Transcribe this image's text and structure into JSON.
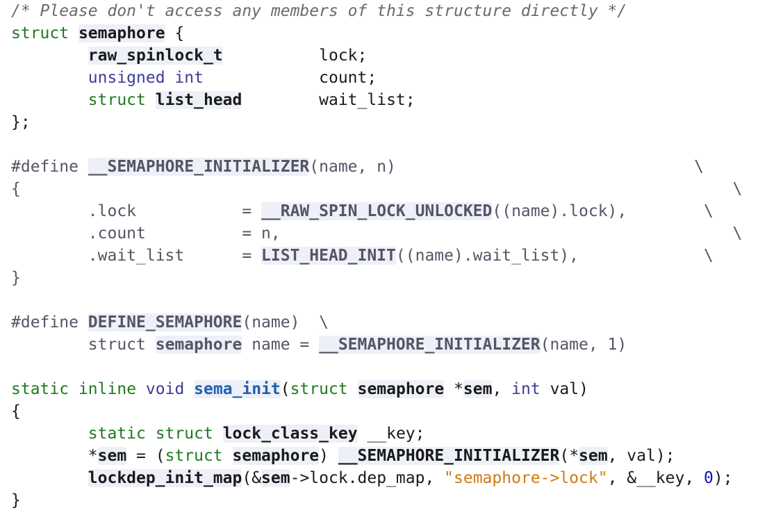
{
  "editor": {
    "language": "C",
    "colors": {
      "comment": "#6a6a6a",
      "keyword": "#1e7a1e",
      "type": "#3c3c9a",
      "function": "#2060b0",
      "string": "#d07a10",
      "number": "#1010c0",
      "preprocessor": "#556677",
      "reference_bg": "#eef0f8"
    },
    "lines": [
      [
        {
          "t": "/* Please don't access any members of this structure directly */",
          "c": "comment"
        }
      ],
      [
        {
          "t": "struct",
          "c": "kw"
        },
        {
          "t": " ",
          "c": "plain"
        },
        {
          "t": "semaphore",
          "c": "ref"
        },
        {
          "t": " {",
          "c": "plain"
        }
      ],
      [
        {
          "t": "        ",
          "c": "plain"
        },
        {
          "t": "raw_spinlock_t",
          "c": "ref"
        },
        {
          "t": "          lock;",
          "c": "plain"
        }
      ],
      [
        {
          "t": "        ",
          "c": "plain"
        },
        {
          "t": "unsigned int",
          "c": "type"
        },
        {
          "t": "            count;",
          "c": "plain"
        }
      ],
      [
        {
          "t": "        ",
          "c": "plain"
        },
        {
          "t": "struct",
          "c": "kw"
        },
        {
          "t": " ",
          "c": "plain"
        },
        {
          "t": "list_head",
          "c": "ref"
        },
        {
          "t": "        wait_list;",
          "c": "plain"
        }
      ],
      [
        {
          "t": "};",
          "c": "plain"
        }
      ],
      [],
      [
        {
          "t": "#define ",
          "c": "pp"
        },
        {
          "t": "__SEMAPHORE_INITIALIZER",
          "c": "refg"
        },
        {
          "t": "(name, n)                               \\",
          "c": "pp"
        }
      ],
      [
        {
          "t": "{                                                                          \\",
          "c": "pp"
        }
      ],
      [
        {
          "t": "        .lock           = ",
          "c": "pp"
        },
        {
          "t": "__RAW_SPIN_LOCK_UNLOCKED",
          "c": "refg"
        },
        {
          "t": "((name).lock),        \\",
          "c": "pp"
        }
      ],
      [
        {
          "t": "        .count          = n,                                               \\",
          "c": "pp"
        }
      ],
      [
        {
          "t": "        .wait_list      = ",
          "c": "pp"
        },
        {
          "t": "LIST_HEAD_INIT",
          "c": "refg"
        },
        {
          "t": "((name).wait_list),             \\",
          "c": "pp"
        }
      ],
      [
        {
          "t": "}",
          "c": "pp"
        }
      ],
      [],
      [
        {
          "t": "#define ",
          "c": "pp"
        },
        {
          "t": "DEFINE_SEMAPHORE",
          "c": "refg"
        },
        {
          "t": "(name)  \\",
          "c": "pp"
        }
      ],
      [
        {
          "t": "        struct ",
          "c": "pp"
        },
        {
          "t": "semaphore",
          "c": "refg"
        },
        {
          "t": " name = ",
          "c": "pp"
        },
        {
          "t": "__SEMAPHORE_INITIALIZER",
          "c": "refg"
        },
        {
          "t": "(name, 1)",
          "c": "pp"
        }
      ],
      [],
      [
        {
          "t": "static",
          "c": "kw"
        },
        {
          "t": " ",
          "c": "plain"
        },
        {
          "t": "inline",
          "c": "kw"
        },
        {
          "t": " ",
          "c": "plain"
        },
        {
          "t": "void",
          "c": "type"
        },
        {
          "t": " ",
          "c": "plain"
        },
        {
          "t": "sema_init",
          "c": "fn"
        },
        {
          "t": "(",
          "c": "plain"
        },
        {
          "t": "struct",
          "c": "kw"
        },
        {
          "t": " ",
          "c": "plain"
        },
        {
          "t": "semaphore",
          "c": "ref"
        },
        {
          "t": " *",
          "c": "plain"
        },
        {
          "t": "sem",
          "c": "ref"
        },
        {
          "t": ", ",
          "c": "plain"
        },
        {
          "t": "int",
          "c": "type"
        },
        {
          "t": " val)",
          "c": "plain"
        }
      ],
      [
        {
          "t": "{",
          "c": "plain"
        }
      ],
      [
        {
          "t": "        ",
          "c": "plain"
        },
        {
          "t": "static",
          "c": "kw"
        },
        {
          "t": " ",
          "c": "plain"
        },
        {
          "t": "struct",
          "c": "kw"
        },
        {
          "t": " ",
          "c": "plain"
        },
        {
          "t": "lock_class_key",
          "c": "ref"
        },
        {
          "t": " __key;",
          "c": "plain"
        }
      ],
      [
        {
          "t": "        *",
          "c": "plain"
        },
        {
          "t": "sem",
          "c": "ref"
        },
        {
          "t": " = (",
          "c": "plain"
        },
        {
          "t": "struct",
          "c": "kw"
        },
        {
          "t": " ",
          "c": "plain"
        },
        {
          "t": "semaphore",
          "c": "ref"
        },
        {
          "t": ") ",
          "c": "plain"
        },
        {
          "t": "__SEMAPHORE_INITIALIZER",
          "c": "ref"
        },
        {
          "t": "(*",
          "c": "plain"
        },
        {
          "t": "sem",
          "c": "ref"
        },
        {
          "t": ", val);",
          "c": "plain"
        }
      ],
      [
        {
          "t": "        ",
          "c": "plain"
        },
        {
          "t": "lockdep_init_map",
          "c": "ref"
        },
        {
          "t": "(&",
          "c": "plain"
        },
        {
          "t": "sem",
          "c": "ref"
        },
        {
          "t": "->lock.dep_map, ",
          "c": "plain"
        },
        {
          "t": "\"semaphore->lock\"",
          "c": "str"
        },
        {
          "t": ", &__key, ",
          "c": "plain"
        },
        {
          "t": "0",
          "c": "num"
        },
        {
          "t": ");",
          "c": "plain"
        }
      ],
      [
        {
          "t": "}",
          "c": "plain"
        }
      ]
    ]
  }
}
